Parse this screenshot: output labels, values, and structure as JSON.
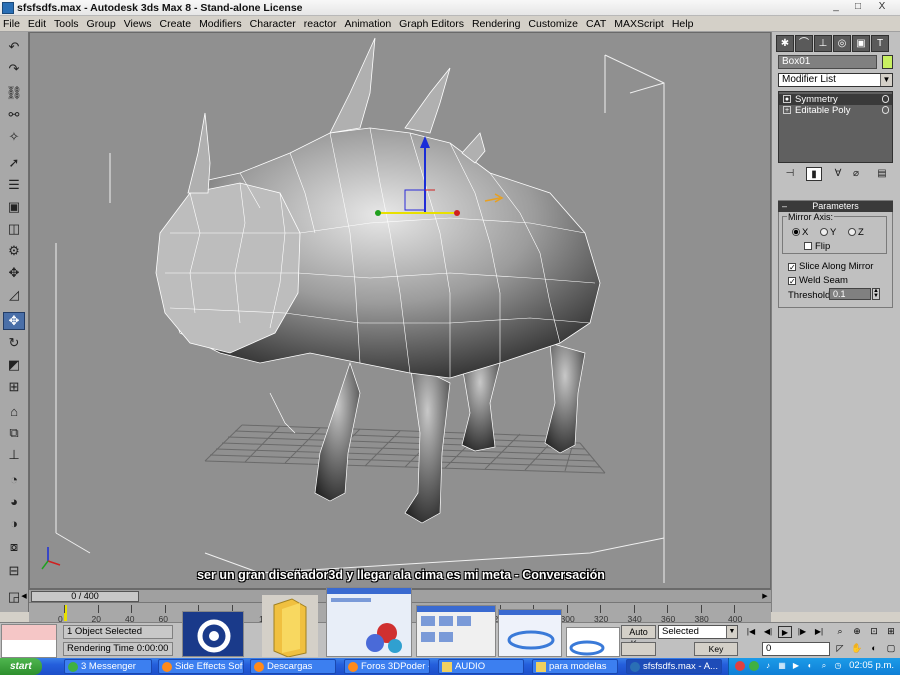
{
  "window": {
    "title": "sfsfsdfs.max - Autodesk 3ds Max 8  - Stand-alone License",
    "min": "_",
    "max": "□",
    "close": "X"
  },
  "menu": [
    "File",
    "Edit",
    "Tools",
    "Group",
    "Views",
    "Create",
    "Modifiers",
    "Character",
    "reactor",
    "Animation",
    "Graph Editors",
    "Rendering",
    "Customize",
    "CAT",
    "MAXScript",
    "Help"
  ],
  "viewport": {
    "caption": "ser un gran diseñador3d y llegar ala cima es mi meta - Conversación"
  },
  "command_panel": {
    "object_name": "Box01",
    "object_color": "#c8f060",
    "modifier_list": "Modifier List",
    "stack": [
      "Symmetry",
      "Editable Poly"
    ],
    "params_title": "Parameters",
    "mirror_axis_label": "Mirror Axis:",
    "axes": [
      "X",
      "Y",
      "Z"
    ],
    "selected_axis": "X",
    "flip_label": "Flip",
    "slice_label": "Slice Along Mirror",
    "weld_label": "Weld Seam",
    "threshold_label": "Threshold:",
    "threshold_value": "0.1"
  },
  "timeline": {
    "frame_display": "0 / 400",
    "ticks": [
      "0",
      "20",
      "40",
      "60",
      "80",
      "100",
      "120",
      "140",
      "160",
      "180",
      "200",
      "220",
      "240",
      "260",
      "280",
      "300",
      "320",
      "340",
      "360",
      "380",
      "400"
    ]
  },
  "status": {
    "selection": "1 Object Selected",
    "render_time": "Rendering Time  0:00:00",
    "auto_key": "Auto Key",
    "selected_filter": "Selected",
    "key_filters": "Key Filters...",
    "frame_value": "0"
  },
  "taskbar": {
    "start": "start",
    "tasks": [
      {
        "label": "3 Messenger"
      },
      {
        "label": "Side Effects Sof..."
      },
      {
        "label": "Descargas"
      },
      {
        "label": "Foros 3DPoder -..."
      },
      {
        "label": "AUDIO"
      },
      {
        "label": "para modelas"
      },
      {
        "label": "sfsfsdfs.max - A..."
      }
    ],
    "clock": "02:05 p.m."
  }
}
